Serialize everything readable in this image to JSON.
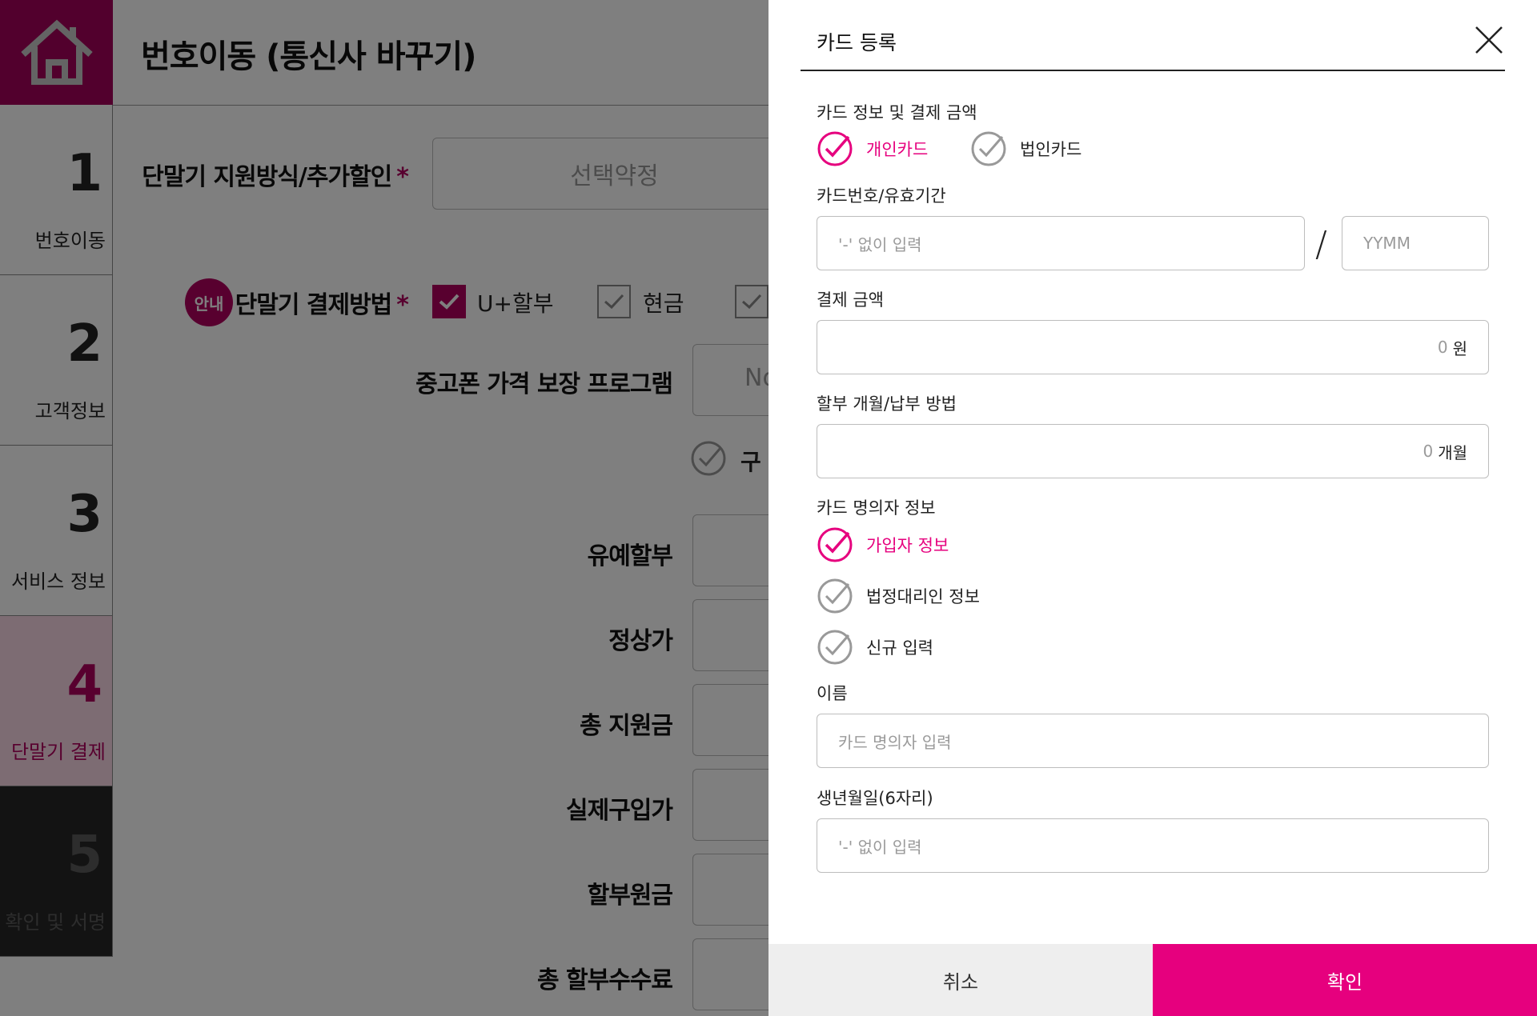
{
  "app": {
    "header": {
      "title": "번호이동 (통신사 바꾸기)"
    },
    "steps": [
      {
        "num": "1",
        "label": "번호이동"
      },
      {
        "num": "2",
        "label": "고객정보"
      },
      {
        "num": "3",
        "label": "서비스 정보"
      },
      {
        "num": "4",
        "label": "단말기 결제"
      },
      {
        "num": "5",
        "label": "확인 및 서명"
      }
    ],
    "form": {
      "support_label": "단말기 지원방식/추가할인",
      "support_value": "선택약정",
      "info_badge": "안내",
      "payment_label": "단말기 결제방법",
      "required_mark": "*",
      "pay_options": [
        "U+할부",
        "현금"
      ],
      "used_phone_label": "중고폰 가격 보장 프로그램",
      "used_phone_value": "No",
      "used_phone_option": "구",
      "rows": [
        "유예할부",
        "정상가",
        "총 지원금",
        "실제구입가",
        "할부원금",
        "총 할부수수료"
      ]
    }
  },
  "drawer": {
    "title": "카드 등록",
    "card_section": {
      "label": "카드 정보 및 결제 금액",
      "options": [
        {
          "label": "개인카드",
          "selected": true
        },
        {
          "label": "법인카드",
          "selected": false
        }
      ]
    },
    "card_number": {
      "label": "카드번호/유효기간",
      "placeholder": "'-' 없이 입력",
      "separator": "/",
      "expiry_placeholder": "YYMM"
    },
    "amount": {
      "label": "결제 금액",
      "value": "0",
      "unit": "원"
    },
    "installment": {
      "label": "할부 개월/납부 방법",
      "value": "0",
      "unit": "개월"
    },
    "holder_section": {
      "label": "카드 명의자 정보",
      "options": [
        {
          "label": "가입자 정보",
          "selected": true
        },
        {
          "label": "법정대리인 정보",
          "selected": false
        },
        {
          "label": "신규 입력",
          "selected": false
        }
      ]
    },
    "name": {
      "label": "이름",
      "placeholder": "카드 명의자 입력"
    },
    "birth": {
      "label": "생년월일(6자리)",
      "placeholder": "'-' 없이 입력"
    },
    "buttons": {
      "cancel": "취소",
      "ok": "확인"
    }
  },
  "colors": {
    "accent": "#e6007e",
    "brand": "#a4005a",
    "dim_overlay": "rgba(0,0,0,0.5)"
  }
}
